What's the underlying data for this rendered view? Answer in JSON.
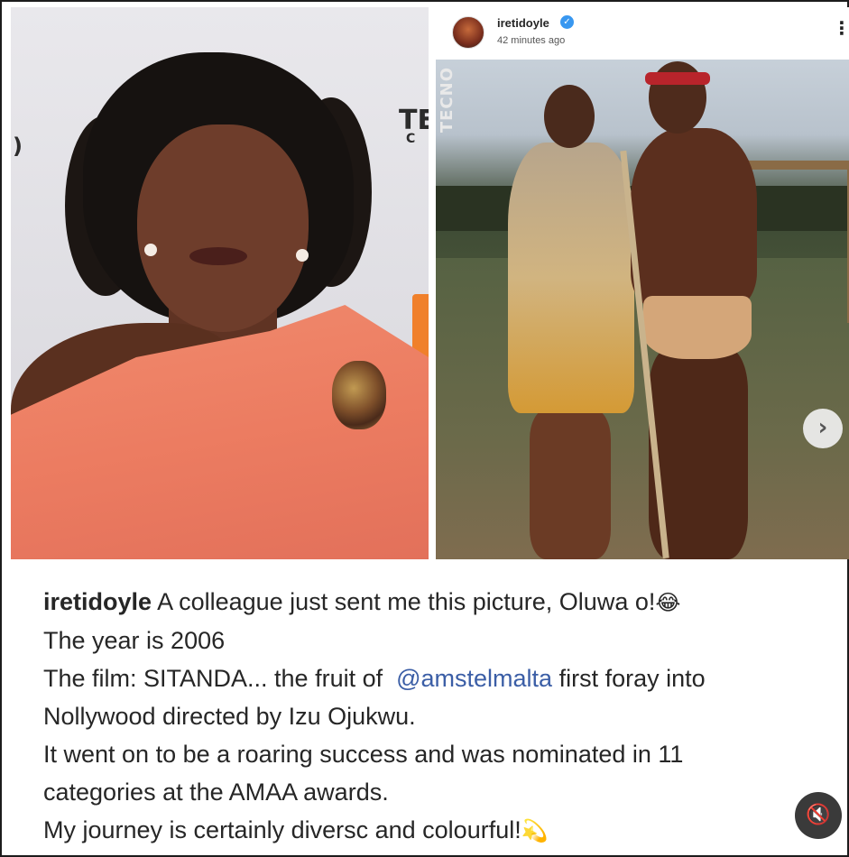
{
  "post": {
    "username": "iretidoyle",
    "timestamp": "42 minutes ago",
    "more_icon": "⋮",
    "verified_icon": "✓"
  },
  "left_image": {
    "backdrop_text_1": "TE",
    "backdrop_text_2": "C",
    "backdrop_text_3": ")"
  },
  "right_image": {
    "watermark": "TECNO"
  },
  "carousel": {
    "next_icon": "›"
  },
  "caption": {
    "username": "iretidoyle",
    "line1": "A colleague just sent me this picture, Oluwa o!",
    "line1_emoji": "😂",
    "line2": "The year is 2006",
    "line3_pre": "The film: SITANDA... the fruit of  ",
    "line3_mention": "@amstelmalta",
    "line3_post": " first foray into",
    "line4": "Nollywood directed by Izu Ojukwu.",
    "line5": "It went on to be a roaring success and was nominated in 11",
    "line6": "categories at the AMAA awards.",
    "line7": "My journey is certainly diversc and colourful!",
    "line7_emoji": "💫"
  },
  "controls": {
    "mute_icon": "🔇"
  },
  "colors": {
    "accent_blue": "#3897f0",
    "mention_blue": "#3b5ea6",
    "dress_coral": "#ec7c61"
  }
}
